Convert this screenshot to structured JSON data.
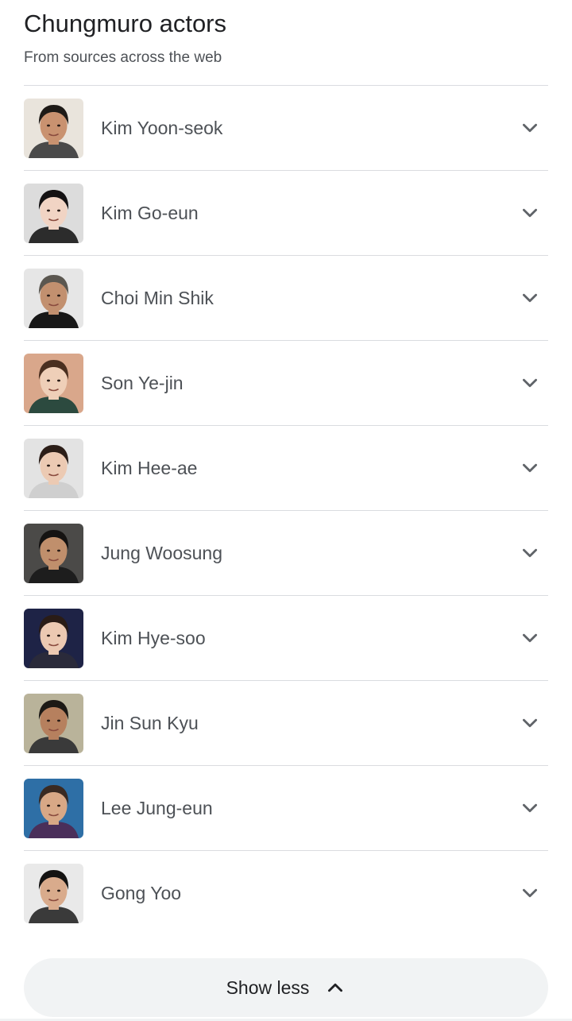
{
  "header": {
    "title": "Chungmuro actors",
    "subtitle": "From sources across the web"
  },
  "actors": [
    {
      "name": "Kim Yoon-seok",
      "bg": "#e9e4dc",
      "skin": "#c99270",
      "hair": "#1e1a17",
      "outfit": "#4a4a4a",
      "icon": "chevron-down-icon"
    },
    {
      "name": "Kim Go-eun",
      "bg": "#dcdcdc",
      "skin": "#f1d4c4",
      "hair": "#141213",
      "outfit": "#2c2c2c",
      "icon": "chevron-down-icon"
    },
    {
      "name": "Choi Min Shik",
      "bg": "#e6e6e6",
      "skin": "#c2906f",
      "hair": "#5b5750",
      "outfit": "#181818",
      "icon": "chevron-down-icon"
    },
    {
      "name": "Son Ye-jin",
      "bg": "#d9a78b",
      "skin": "#efcfb8",
      "hair": "#4a2f20",
      "outfit": "#2c4a3f",
      "icon": "chevron-down-icon"
    },
    {
      "name": "Kim Hee-ae",
      "bg": "#e3e3e3",
      "skin": "#eccab3",
      "hair": "#2c1e18",
      "outfit": "#cfcfcf",
      "icon": "chevron-down-icon"
    },
    {
      "name": "Jung Woosung",
      "bg": "#4b4a48",
      "skin": "#c08f6c",
      "hair": "#151312",
      "outfit": "#1d1d1d",
      "icon": "chevron-down-icon"
    },
    {
      "name": "Kim Hye-soo",
      "bg": "#1e2346",
      "skin": "#ecc9b2",
      "hair": "#2a1c16",
      "outfit": "#2a2a3a",
      "icon": "chevron-down-icon"
    },
    {
      "name": "Jin Sun Kyu",
      "bg": "#b9b39a",
      "skin": "#b6805e",
      "hair": "#1c1915",
      "outfit": "#3a3a3a",
      "icon": "chevron-down-icon"
    },
    {
      "name": "Lee Jung-eun",
      "bg": "#2e6fa6",
      "skin": "#d8a886",
      "hair": "#3a2a22",
      "outfit": "#4a2f5a",
      "icon": "chevron-down-icon"
    },
    {
      "name": "Gong Yoo",
      "bg": "#e9e9e9",
      "skin": "#d9ab8c",
      "hair": "#141312",
      "outfit": "#3a3a3a",
      "icon": "chevron-down-icon"
    }
  ],
  "footer": {
    "show_less_label": "Show less",
    "icon": "chevron-up-icon"
  },
  "colors": {
    "title": "#202124",
    "secondary_text": "#4d5156",
    "divider": "#dadce0",
    "chevron": "#5f6368",
    "button_bg": "#f1f3f4"
  }
}
